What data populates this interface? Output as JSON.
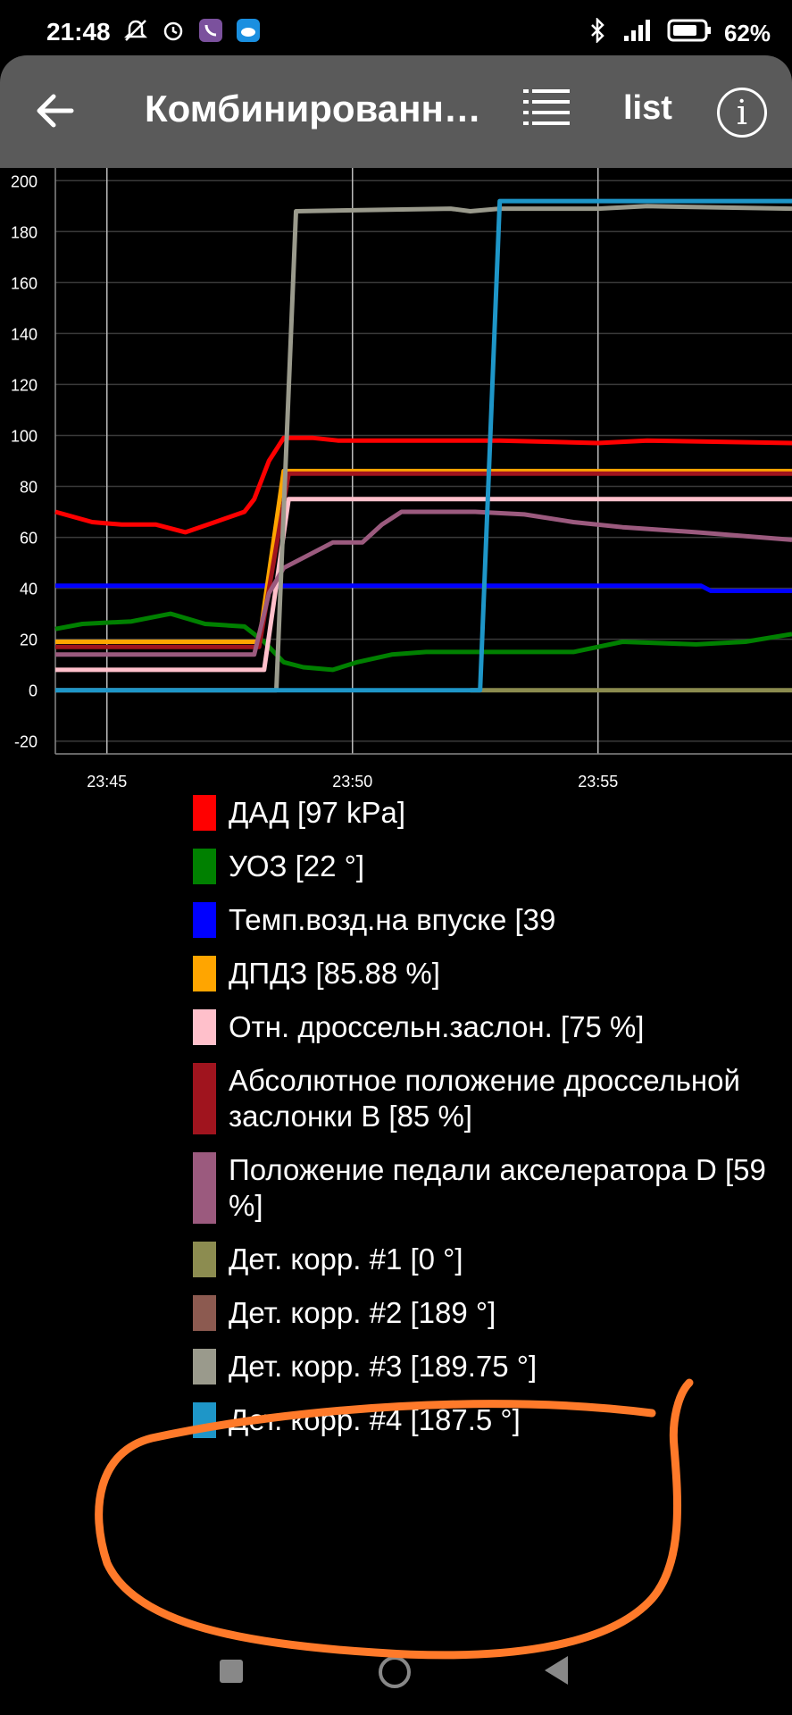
{
  "status_bar": {
    "time": "21:48",
    "battery": "62%"
  },
  "app_bar": {
    "title": "Комбинированн…",
    "list_label": "list",
    "info_label": "i"
  },
  "colors": {
    "red": "#ff0000",
    "green": "#008000",
    "blue": "#0000ff",
    "orange": "#ffa500",
    "pink": "#ffc0cb",
    "darkred": "#a0141e",
    "mauve": "#9b5a7e",
    "olive": "#8c8c50",
    "brown": "#8c5a50",
    "gray": "#9a9a8c",
    "cyan": "#1e96c8"
  },
  "chart_data": {
    "type": "line",
    "ylim": [
      -25,
      205
    ],
    "yticks": [
      "200",
      "180",
      "160",
      "140",
      "120",
      "100",
      "80",
      "60",
      "40",
      "20",
      "0",
      "-20"
    ],
    "xticks": [
      "23:45",
      "23:50",
      "23:55"
    ],
    "x_tick_positions": [
      45,
      50,
      55
    ],
    "xlim": [
      43.95,
      58.95
    ],
    "series": [
      {
        "name": "ДАД [97 kPa]",
        "color": "#ff0000",
        "points": [
          [
            43.95,
            70
          ],
          [
            44.7,
            66
          ],
          [
            45.3,
            65
          ],
          [
            46.0,
            65
          ],
          [
            46.6,
            62
          ],
          [
            47.2,
            66
          ],
          [
            47.8,
            70
          ],
          [
            48.0,
            75
          ],
          [
            48.3,
            90
          ],
          [
            48.6,
            99
          ],
          [
            49.2,
            99
          ],
          [
            49.7,
            98
          ],
          [
            51.0,
            98
          ],
          [
            53.0,
            98
          ],
          [
            55.0,
            97
          ],
          [
            56.0,
            98
          ],
          [
            58.95,
            97
          ]
        ]
      },
      {
        "name": "УОЗ [22 °]",
        "color": "#008000",
        "points": [
          [
            43.95,
            24
          ],
          [
            44.5,
            26
          ],
          [
            45.5,
            27
          ],
          [
            46.3,
            30
          ],
          [
            47.0,
            26
          ],
          [
            47.8,
            25
          ],
          [
            48.2,
            19
          ],
          [
            48.6,
            11
          ],
          [
            49.0,
            9
          ],
          [
            49.6,
            8
          ],
          [
            50.1,
            11
          ],
          [
            50.8,
            14
          ],
          [
            51.5,
            15
          ],
          [
            52.3,
            15
          ],
          [
            53.0,
            15
          ],
          [
            54.0,
            15
          ],
          [
            54.5,
            15
          ],
          [
            55.5,
            19
          ],
          [
            57.0,
            18
          ],
          [
            58.0,
            19
          ],
          [
            58.95,
            22
          ]
        ]
      },
      {
        "name": "Темп.возд.на впуске [39",
        "color": "#0000ff",
        "points": [
          [
            43.95,
            41
          ],
          [
            57.1,
            41
          ],
          [
            57.3,
            39
          ],
          [
            58.95,
            39
          ]
        ]
      },
      {
        "name": "ДПДЗ [85.88 %]",
        "color": "#ffa500",
        "points": [
          [
            43.95,
            19
          ],
          [
            47.0,
            19
          ],
          [
            48.1,
            19
          ],
          [
            48.6,
            86
          ],
          [
            58.95,
            86
          ]
        ]
      },
      {
        "name": "Отн. дроссельн.заслон. [75 %]",
        "color": "#ffc0cb",
        "points": [
          [
            43.95,
            8
          ],
          [
            48.2,
            8
          ],
          [
            48.7,
            75
          ],
          [
            58.95,
            75
          ]
        ]
      },
      {
        "name": "Абсолютное положение дроссельной заслонки В [85 %]",
        "color": "#a0141e",
        "points": [
          [
            43.95,
            17
          ],
          [
            48.1,
            17
          ],
          [
            48.7,
            85
          ],
          [
            58.95,
            85
          ]
        ]
      },
      {
        "name": "Положение педали акселератора D [59 %]",
        "color": "#9b5a7e",
        "points": [
          [
            43.95,
            14
          ],
          [
            48.0,
            14
          ],
          [
            48.3,
            38
          ],
          [
            48.6,
            48
          ],
          [
            49.2,
            54
          ],
          [
            49.6,
            58
          ],
          [
            50.2,
            58
          ],
          [
            50.6,
            65
          ],
          [
            51.0,
            70
          ],
          [
            52.5,
            70
          ],
          [
            53.5,
            69
          ],
          [
            54.5,
            66
          ],
          [
            55.5,
            64
          ],
          [
            57.0,
            62
          ],
          [
            58.95,
            59
          ]
        ]
      },
      {
        "name": "Дет. корр. #1 [0 °]",
        "color": "#8c8c50",
        "points": [
          [
            52.4,
            0
          ],
          [
            58.95,
            0
          ]
        ]
      },
      {
        "name": "Дет. корр. #2 [189 °]",
        "color": "#8c5a50",
        "points": []
      },
      {
        "name": "Дет. корр. #3 [189.75 °]",
        "color": "#9a9a8c",
        "points": [
          [
            43.95,
            0
          ],
          [
            48.45,
            0
          ],
          [
            48.85,
            188
          ],
          [
            52.0,
            189
          ],
          [
            52.4,
            188
          ],
          [
            53.0,
            189
          ],
          [
            54.0,
            189
          ],
          [
            55.0,
            189
          ],
          [
            56.0,
            190
          ],
          [
            58.95,
            189
          ]
        ]
      },
      {
        "name": "Дет. корр. #4 [187.5 °]",
        "color": "#1e96c8",
        "points": [
          [
            43.95,
            0
          ],
          [
            52.6,
            0
          ],
          [
            53.0,
            192
          ],
          [
            58.95,
            192
          ]
        ]
      }
    ]
  }
}
